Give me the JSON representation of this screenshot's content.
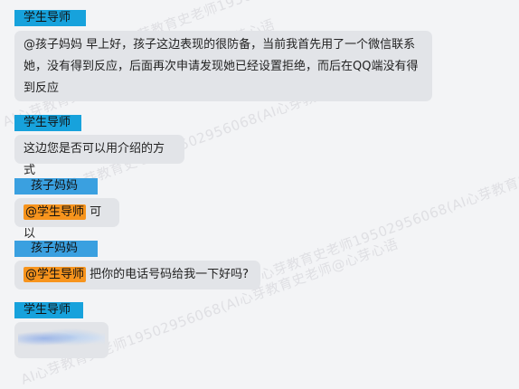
{
  "watermark": {
    "text_1": "AI心芽教育史老师19502956068(AI心芽",
    "text_2": "AI心芽教育史老师19502956068(AI心芽心语",
    "text_3": "AI心芽教育史老师19502956068(AI心芽教育史老师",
    "text_4": "AI心芽教育史老师19502956068(AI心芽教育史老师@心芽心语",
    "text_5": "AI心芽教育史老师19502956068(AI心芽教育史老师@心芽心语"
  },
  "messages": [
    {
      "sender": "学生导师",
      "text": "@孩子妈妈 早上好，孩子这边表现的很防备，当前我首先用了一个微信联系她，没有得到反应，后面再次申请发现她已经设置拒绝，而后在QQ端没有得到反应"
    },
    {
      "sender": "学生导师",
      "text": "这边您是否可以用介绍的方式"
    },
    {
      "sender": "孩子妈妈",
      "mention": "@学生导师",
      "text": "可以"
    },
    {
      "sender": "孩子妈妈",
      "mention": "@学生导师",
      "text": "把你的电话号码给我一下好吗?"
    },
    {
      "sender": "学生导师",
      "image": "blurred-image"
    }
  ]
}
